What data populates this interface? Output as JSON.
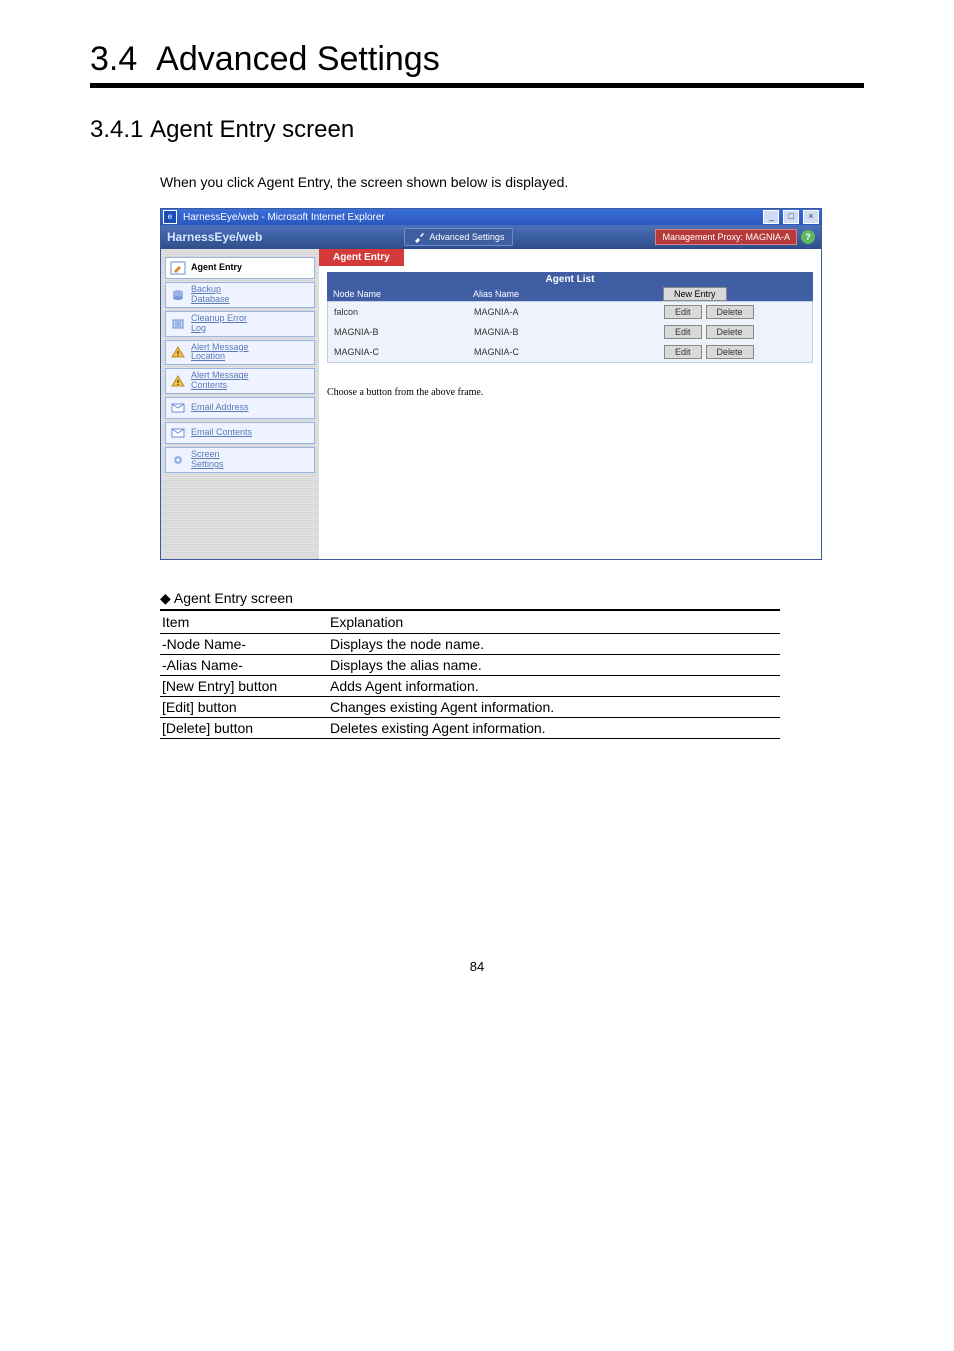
{
  "doc": {
    "section_number": "3.4",
    "section_title": "Advanced Settings",
    "subsection_number": "3.4.1",
    "subsection_title": "Agent Entry screen",
    "intro": "When you click Agent Entry, the screen shown below is displayed.",
    "page_number": "84"
  },
  "window": {
    "title": "HarnessEye/web - Microsoft Internet Explorer",
    "logo_a": "HarnessEye",
    "logo_b": "/web",
    "breadcrumb": "Advanced Settings",
    "proxy_label": "Management Proxy: MAGNIA-A",
    "help": "?"
  },
  "sidebar": [
    {
      "name": "agent-entry",
      "label": "Agent Entry",
      "active": true,
      "icon": "pencil"
    },
    {
      "name": "backup-database",
      "label": "Backup\nDatabase",
      "active": false,
      "icon": "db"
    },
    {
      "name": "cleanup-error-log",
      "label": "Cleanup Error\nLog",
      "active": false,
      "icon": "broom"
    },
    {
      "name": "alert-message-location",
      "label": "Alert Message\nLocation",
      "active": false,
      "icon": "alert"
    },
    {
      "name": "alert-message-contents",
      "label": "Alert Message\nContents",
      "active": false,
      "icon": "alert"
    },
    {
      "name": "email-address",
      "label": "Email Address",
      "active": false,
      "icon": "mail"
    },
    {
      "name": "email-contents",
      "label": "Email Contents",
      "active": false,
      "icon": "mail"
    },
    {
      "name": "screen-settings",
      "label": "Screen\nSettings",
      "active": false,
      "icon": "gear"
    }
  ],
  "panel": {
    "tab": "Agent Entry",
    "list_title": "Agent List",
    "col_node": "Node Name",
    "col_alias": "Alias Name",
    "new_entry": "New Entry",
    "edit": "Edit",
    "delete": "Delete",
    "rows": [
      {
        "node": "falcon",
        "alias": "MAGNIA-A"
      },
      {
        "node": "MAGNIA-B",
        "alias": "MAGNIA-B"
      },
      {
        "node": "MAGNIA-C",
        "alias": "MAGNIA-C"
      }
    ],
    "hint": "Choose a button from the above frame."
  },
  "explain": {
    "title": "◆ Agent Entry screen",
    "head_item": "Item",
    "head_expl": "Explanation",
    "rows": [
      {
        "item": "-Node Name-",
        "expl": "Displays the node name."
      },
      {
        "item": "-Alias Name-",
        "expl": "Displays the alias name."
      },
      {
        "item": "[New Entry] button",
        "expl": "Adds Agent information."
      },
      {
        "item": "[Edit] button",
        "expl": "Changes existing Agent information."
      },
      {
        "item": "[Delete] button",
        "expl": "Deletes existing Agent information."
      }
    ]
  }
}
